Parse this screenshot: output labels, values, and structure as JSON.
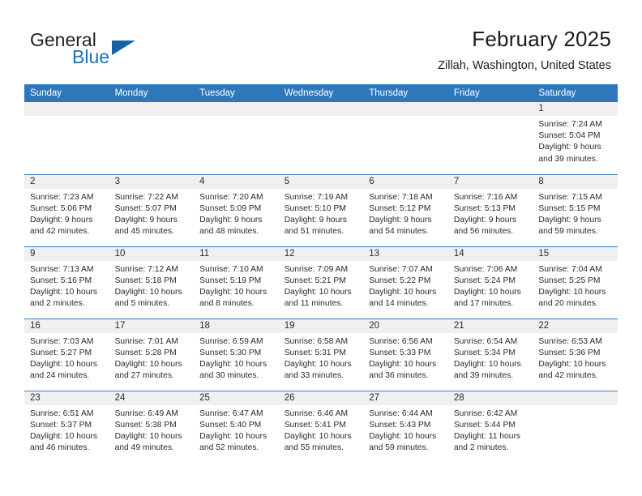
{
  "brand": {
    "word_one": "General",
    "word_two": "Blue",
    "triangle_icon": "triangle-icon",
    "accent_color": "#1b72b8"
  },
  "header": {
    "title": "February 2025",
    "location": "Zillah, Washington, United States"
  },
  "calendar": {
    "header_bg": "#2e77bb",
    "daynum_bg": "#f0f0f0",
    "weekday_headers": [
      "Sunday",
      "Monday",
      "Tuesday",
      "Wednesday",
      "Thursday",
      "Friday",
      "Saturday"
    ],
    "weeks": [
      [
        {
          "day": "",
          "sunrise": "",
          "sunset": "",
          "daylight_line1": "",
          "daylight_line2": "",
          "empty": true
        },
        {
          "day": "",
          "sunrise": "",
          "sunset": "",
          "daylight_line1": "",
          "daylight_line2": "",
          "empty": true
        },
        {
          "day": "",
          "sunrise": "",
          "sunset": "",
          "daylight_line1": "",
          "daylight_line2": "",
          "empty": true
        },
        {
          "day": "",
          "sunrise": "",
          "sunset": "",
          "daylight_line1": "",
          "daylight_line2": "",
          "empty": true
        },
        {
          "day": "",
          "sunrise": "",
          "sunset": "",
          "daylight_line1": "",
          "daylight_line2": "",
          "empty": true
        },
        {
          "day": "",
          "sunrise": "",
          "sunset": "",
          "daylight_line1": "",
          "daylight_line2": "",
          "empty": true
        },
        {
          "day": "1",
          "sunrise": "Sunrise: 7:24 AM",
          "sunset": "Sunset: 5:04 PM",
          "daylight_line1": "Daylight: 9 hours",
          "daylight_line2": "and 39 minutes.",
          "empty": false
        }
      ],
      [
        {
          "day": "2",
          "sunrise": "Sunrise: 7:23 AM",
          "sunset": "Sunset: 5:06 PM",
          "daylight_line1": "Daylight: 9 hours",
          "daylight_line2": "and 42 minutes.",
          "empty": false
        },
        {
          "day": "3",
          "sunrise": "Sunrise: 7:22 AM",
          "sunset": "Sunset: 5:07 PM",
          "daylight_line1": "Daylight: 9 hours",
          "daylight_line2": "and 45 minutes.",
          "empty": false
        },
        {
          "day": "4",
          "sunrise": "Sunrise: 7:20 AM",
          "sunset": "Sunset: 5:09 PM",
          "daylight_line1": "Daylight: 9 hours",
          "daylight_line2": "and 48 minutes.",
          "empty": false
        },
        {
          "day": "5",
          "sunrise": "Sunrise: 7:19 AM",
          "sunset": "Sunset: 5:10 PM",
          "daylight_line1": "Daylight: 9 hours",
          "daylight_line2": "and 51 minutes.",
          "empty": false
        },
        {
          "day": "6",
          "sunrise": "Sunrise: 7:18 AM",
          "sunset": "Sunset: 5:12 PM",
          "daylight_line1": "Daylight: 9 hours",
          "daylight_line2": "and 54 minutes.",
          "empty": false
        },
        {
          "day": "7",
          "sunrise": "Sunrise: 7:16 AM",
          "sunset": "Sunset: 5:13 PM",
          "daylight_line1": "Daylight: 9 hours",
          "daylight_line2": "and 56 minutes.",
          "empty": false
        },
        {
          "day": "8",
          "sunrise": "Sunrise: 7:15 AM",
          "sunset": "Sunset: 5:15 PM",
          "daylight_line1": "Daylight: 9 hours",
          "daylight_line2": "and 59 minutes.",
          "empty": false
        }
      ],
      [
        {
          "day": "9",
          "sunrise": "Sunrise: 7:13 AM",
          "sunset": "Sunset: 5:16 PM",
          "daylight_line1": "Daylight: 10 hours",
          "daylight_line2": "and 2 minutes.",
          "empty": false
        },
        {
          "day": "10",
          "sunrise": "Sunrise: 7:12 AM",
          "sunset": "Sunset: 5:18 PM",
          "daylight_line1": "Daylight: 10 hours",
          "daylight_line2": "and 5 minutes.",
          "empty": false
        },
        {
          "day": "11",
          "sunrise": "Sunrise: 7:10 AM",
          "sunset": "Sunset: 5:19 PM",
          "daylight_line1": "Daylight: 10 hours",
          "daylight_line2": "and 8 minutes.",
          "empty": false
        },
        {
          "day": "12",
          "sunrise": "Sunrise: 7:09 AM",
          "sunset": "Sunset: 5:21 PM",
          "daylight_line1": "Daylight: 10 hours",
          "daylight_line2": "and 11 minutes.",
          "empty": false
        },
        {
          "day": "13",
          "sunrise": "Sunrise: 7:07 AM",
          "sunset": "Sunset: 5:22 PM",
          "daylight_line1": "Daylight: 10 hours",
          "daylight_line2": "and 14 minutes.",
          "empty": false
        },
        {
          "day": "14",
          "sunrise": "Sunrise: 7:06 AM",
          "sunset": "Sunset: 5:24 PM",
          "daylight_line1": "Daylight: 10 hours",
          "daylight_line2": "and 17 minutes.",
          "empty": false
        },
        {
          "day": "15",
          "sunrise": "Sunrise: 7:04 AM",
          "sunset": "Sunset: 5:25 PM",
          "daylight_line1": "Daylight: 10 hours",
          "daylight_line2": "and 20 minutes.",
          "empty": false
        }
      ],
      [
        {
          "day": "16",
          "sunrise": "Sunrise: 7:03 AM",
          "sunset": "Sunset: 5:27 PM",
          "daylight_line1": "Daylight: 10 hours",
          "daylight_line2": "and 24 minutes.",
          "empty": false
        },
        {
          "day": "17",
          "sunrise": "Sunrise: 7:01 AM",
          "sunset": "Sunset: 5:28 PM",
          "daylight_line1": "Daylight: 10 hours",
          "daylight_line2": "and 27 minutes.",
          "empty": false
        },
        {
          "day": "18",
          "sunrise": "Sunrise: 6:59 AM",
          "sunset": "Sunset: 5:30 PM",
          "daylight_line1": "Daylight: 10 hours",
          "daylight_line2": "and 30 minutes.",
          "empty": false
        },
        {
          "day": "19",
          "sunrise": "Sunrise: 6:58 AM",
          "sunset": "Sunset: 5:31 PM",
          "daylight_line1": "Daylight: 10 hours",
          "daylight_line2": "and 33 minutes.",
          "empty": false
        },
        {
          "day": "20",
          "sunrise": "Sunrise: 6:56 AM",
          "sunset": "Sunset: 5:33 PM",
          "daylight_line1": "Daylight: 10 hours",
          "daylight_line2": "and 36 minutes.",
          "empty": false
        },
        {
          "day": "21",
          "sunrise": "Sunrise: 6:54 AM",
          "sunset": "Sunset: 5:34 PM",
          "daylight_line1": "Daylight: 10 hours",
          "daylight_line2": "and 39 minutes.",
          "empty": false
        },
        {
          "day": "22",
          "sunrise": "Sunrise: 6:53 AM",
          "sunset": "Sunset: 5:36 PM",
          "daylight_line1": "Daylight: 10 hours",
          "daylight_line2": "and 42 minutes.",
          "empty": false
        }
      ],
      [
        {
          "day": "23",
          "sunrise": "Sunrise: 6:51 AM",
          "sunset": "Sunset: 5:37 PM",
          "daylight_line1": "Daylight: 10 hours",
          "daylight_line2": "and 46 minutes.",
          "empty": false
        },
        {
          "day": "24",
          "sunrise": "Sunrise: 6:49 AM",
          "sunset": "Sunset: 5:38 PM",
          "daylight_line1": "Daylight: 10 hours",
          "daylight_line2": "and 49 minutes.",
          "empty": false
        },
        {
          "day": "25",
          "sunrise": "Sunrise: 6:47 AM",
          "sunset": "Sunset: 5:40 PM",
          "daylight_line1": "Daylight: 10 hours",
          "daylight_line2": "and 52 minutes.",
          "empty": false
        },
        {
          "day": "26",
          "sunrise": "Sunrise: 6:46 AM",
          "sunset": "Sunset: 5:41 PM",
          "daylight_line1": "Daylight: 10 hours",
          "daylight_line2": "and 55 minutes.",
          "empty": false
        },
        {
          "day": "27",
          "sunrise": "Sunrise: 6:44 AM",
          "sunset": "Sunset: 5:43 PM",
          "daylight_line1": "Daylight: 10 hours",
          "daylight_line2": "and 59 minutes.",
          "empty": false
        },
        {
          "day": "28",
          "sunrise": "Sunrise: 6:42 AM",
          "sunset": "Sunset: 5:44 PM",
          "daylight_line1": "Daylight: 11 hours",
          "daylight_line2": "and 2 minutes.",
          "empty": false
        },
        {
          "day": "",
          "sunrise": "",
          "sunset": "",
          "daylight_line1": "",
          "daylight_line2": "",
          "empty": true
        }
      ]
    ]
  }
}
